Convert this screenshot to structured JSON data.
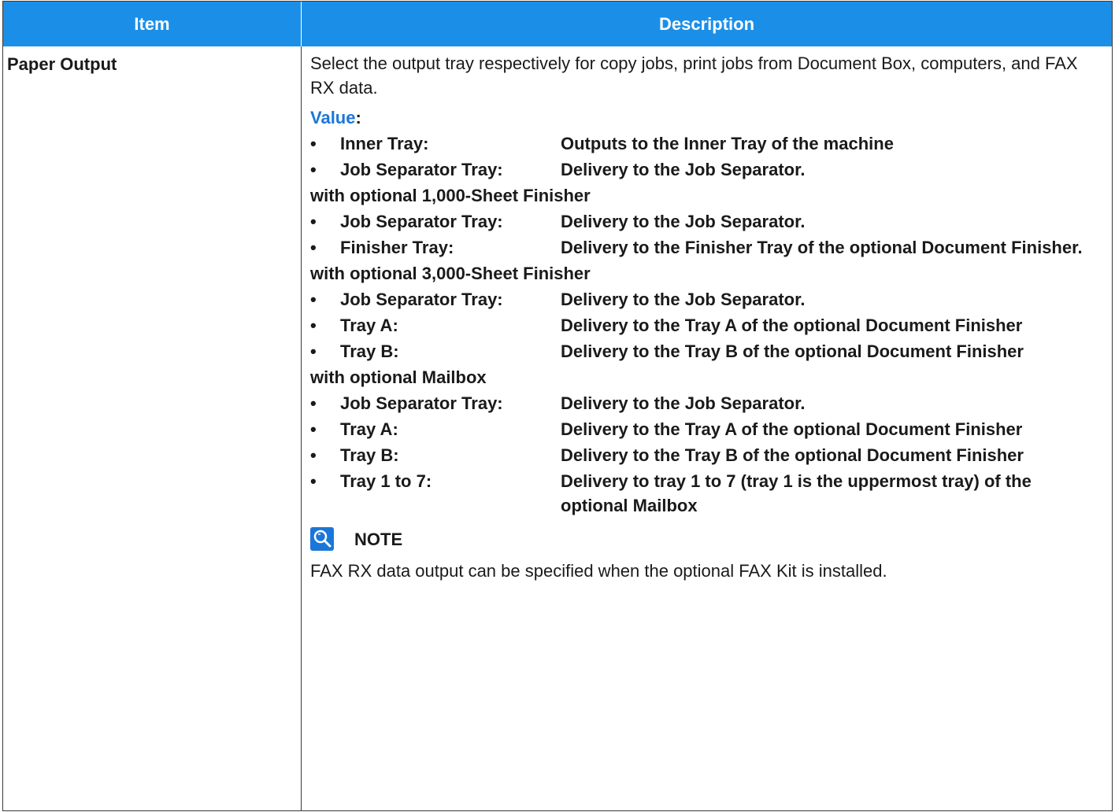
{
  "header": {
    "item": "Item",
    "description": "Description"
  },
  "row": {
    "item": "Paper Output",
    "intro": "Select the output tray respectively for copy jobs, print jobs from Document Box, computers, and FAX RX data.",
    "value_label": "Value",
    "value_colon": ":",
    "bullet": "•",
    "groups": [
      {
        "items": [
          {
            "term": "Inner Tray:",
            "desc": "Outputs to the Inner Tray of the machine"
          },
          {
            "term": "Job Separator Tray:",
            "desc": "Delivery to the Job Separator."
          }
        ]
      },
      {
        "heading": "with optional 1,000-Sheet Finisher",
        "items": [
          {
            "term": "Job Separator Tray:",
            "desc": "Delivery to the Job Separator."
          },
          {
            "term": "Finisher Tray:",
            "desc": "Delivery to the Finisher Tray of the optional Document Finisher."
          }
        ]
      },
      {
        "heading": "with optional 3,000-Sheet Finisher",
        "items": [
          {
            "term": "Job Separator Tray:",
            "desc": "Delivery to the Job Separator."
          },
          {
            "term": "Tray A:",
            "desc": "Delivery to the Tray A of the optional Document Finisher"
          },
          {
            "term": "Tray B:",
            "desc": "Delivery to the Tray B of the optional Document Finisher"
          }
        ]
      },
      {
        "heading": "with optional Mailbox",
        "items": [
          {
            "term": "Job Separator Tray:",
            "desc": "Delivery to the Job Separator."
          },
          {
            "term": "Tray A:",
            "desc": "Delivery to the Tray A of the optional Document Finisher"
          },
          {
            "term": "Tray B:",
            "desc": "Delivery to the Tray B of the optional Document Finisher"
          },
          {
            "term": "Tray 1 to 7:",
            "desc": "Delivery to tray 1 to 7 (tray 1 is the uppermost tray) of the optional Mailbox"
          }
        ]
      }
    ],
    "note_label": "NOTE",
    "note_icon": "note-magnifier-icon",
    "note_text": "FAX RX data output can be specified when the optional FAX Kit is installed."
  },
  "colors": {
    "header_bg": "#1b8fe8",
    "accent": "#1b76d9"
  }
}
